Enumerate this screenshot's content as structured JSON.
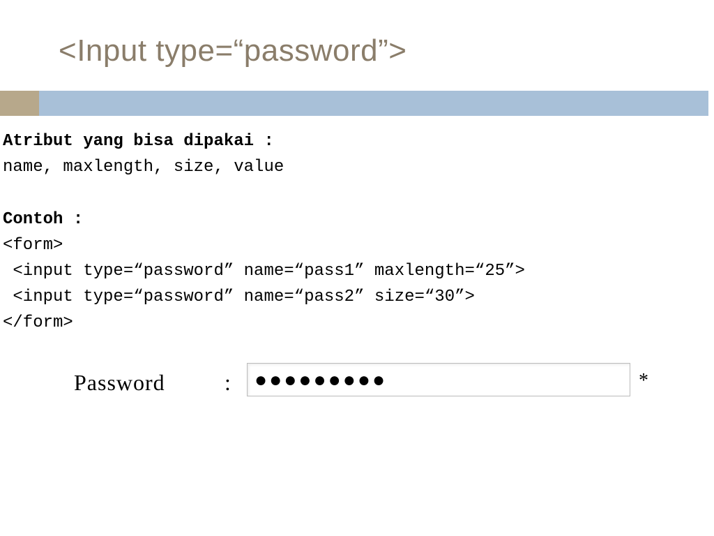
{
  "title": "<Input type=“password”>",
  "body": {
    "attr_heading": "Atribut yang bisa dipakai :",
    "attr_list": "name, maxlength, size, value",
    "example_heading": "Contoh :",
    "code_line1": "<form>",
    "code_line2": " <input type=“password” name=“pass1” maxlength=“25”>",
    "code_line3": " <input type=“password” name=“pass2” size=“30”>",
    "code_line4": "</form>"
  },
  "example": {
    "label": "Password",
    "colon": ":",
    "masked_value": "●●●●●●●●●",
    "required_mark": "*"
  },
  "colors": {
    "title_color": "#8a7d6a",
    "accent_brown": "#b7a88b",
    "accent_blue": "#a8c0d8"
  }
}
